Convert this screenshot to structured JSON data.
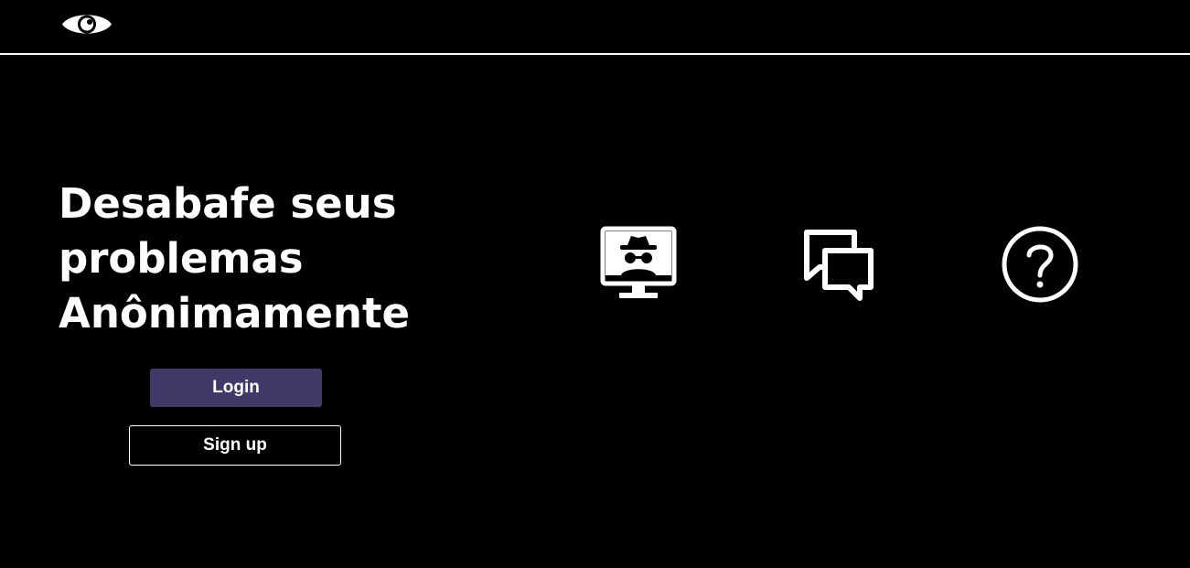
{
  "header": {
    "logo_icon": "eye-icon"
  },
  "hero": {
    "headline_lines": [
      "Desabafe seus",
      "problemas",
      "Anônimamente"
    ]
  },
  "actions": {
    "login_label": "Login",
    "signup_label": "Sign up"
  },
  "features": [
    {
      "icon": "incognito-monitor-icon"
    },
    {
      "icon": "chat-bubbles-icon"
    },
    {
      "icon": "question-circle-icon"
    }
  ],
  "colors": {
    "background": "#000000",
    "foreground": "#ffffff",
    "login_button": "#403a68"
  }
}
